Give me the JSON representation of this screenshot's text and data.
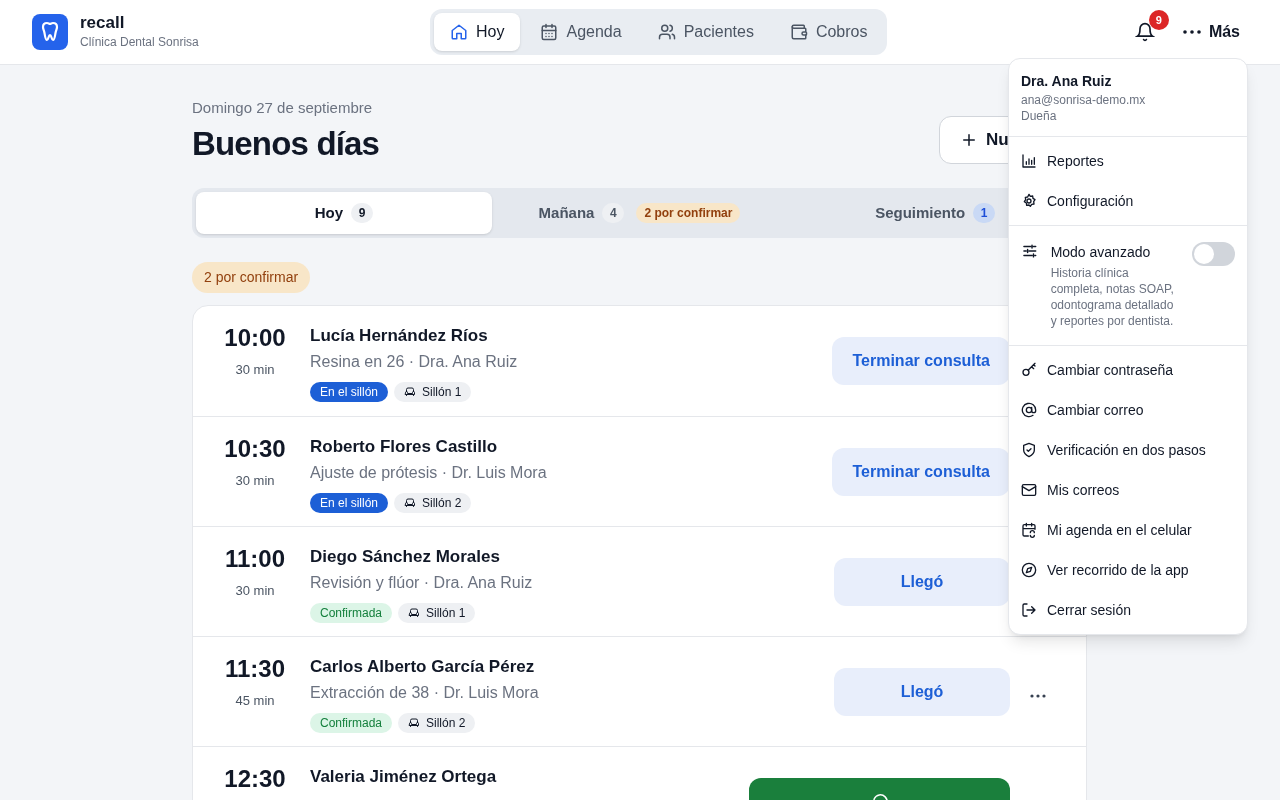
{
  "header": {
    "brand": {
      "name": "recall",
      "subtitle": "Clínica Dental Sonrisa"
    },
    "nav": [
      {
        "label": "Hoy",
        "selected": true
      },
      {
        "label": "Agenda",
        "selected": false
      },
      {
        "label": "Pacientes",
        "selected": false
      },
      {
        "label": "Cobros",
        "selected": false
      }
    ],
    "notifications": {
      "count": "9"
    },
    "more_label": "Más"
  },
  "page": {
    "date": "Domingo 27 de septiembre",
    "greeting": "Buenos días",
    "new_button": "Nu"
  },
  "tabs": [
    {
      "label": "Hoy",
      "count": "9",
      "selected": true,
      "accent": false
    },
    {
      "label": "Mañana",
      "count": "4",
      "pending": "2 por confirmar",
      "selected": false,
      "accent": false
    },
    {
      "label": "Seguimiento",
      "count": "1",
      "selected": false,
      "accent": true
    }
  ],
  "pending_badge": "2 por confirmar",
  "appointments": [
    {
      "time": "10:00",
      "duration": "30 min",
      "patient": "Lucía Hernández Ríos",
      "detail": "Resina en 26 · Dra. Ana Ruiz",
      "status": {
        "label": "En el sillón",
        "kind": "in_chair"
      },
      "chair": "Sillón 1",
      "action": {
        "label": "Terminar consulta",
        "kind": "soft"
      }
    },
    {
      "time": "10:30",
      "duration": "30 min",
      "patient": "Roberto Flores Castillo",
      "detail": "Ajuste de prótesis · Dr. Luis Mora",
      "status": {
        "label": "En el sillón",
        "kind": "in_chair"
      },
      "chair": "Sillón 2",
      "action": {
        "label": "Terminar consulta",
        "kind": "soft"
      }
    },
    {
      "time": "11:00",
      "duration": "30 min",
      "patient": "Diego Sánchez Morales",
      "detail": "Revisión y flúor · Dra. Ana Ruiz",
      "status": {
        "label": "Confirmada",
        "kind": "confirmed"
      },
      "chair": "Sillón 1",
      "action": {
        "label": "Llegó",
        "kind": "soft"
      }
    },
    {
      "time": "11:30",
      "duration": "45 min",
      "patient": "Carlos Alberto García Pérez",
      "detail": "Extracción de 38 · Dr. Luis Mora",
      "status": {
        "label": "Confirmada",
        "kind": "confirmed"
      },
      "chair": "Sillón 2",
      "action": {
        "label": "Llegó",
        "kind": "soft"
      },
      "menu": true
    },
    {
      "time": "12:30",
      "patient": "Valeria Jiménez Ortega",
      "action": {
        "kind": "whatsapp"
      }
    }
  ],
  "menu": {
    "user": {
      "name": "Dra. Ana Ruiz",
      "email": "ana@sonrisa-demo.mx",
      "role": "Dueña"
    },
    "top_items": [
      "Reportes",
      "Configuración"
    ],
    "advanced": {
      "label": "Modo avanzado",
      "description": "Historia clínica completa, notas SOAP, odontograma detallado y reportes por dentista.",
      "on": false
    },
    "account_items": [
      "Cambiar contraseña",
      "Cambiar correo",
      "Verificación en dos pasos",
      "Mis correos",
      "Mi agenda en el celular",
      "Ver recorrido de la app",
      "Cerrar sesión"
    ]
  }
}
